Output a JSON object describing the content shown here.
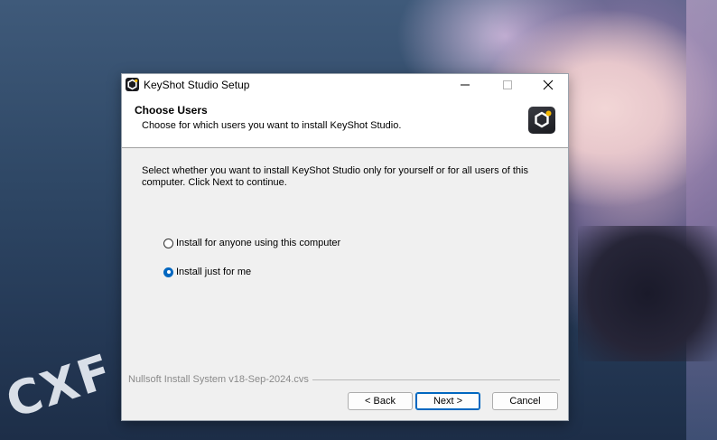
{
  "background": {
    "watermark_text": "CXF"
  },
  "window": {
    "title": "KeyShot Studio Setup",
    "controls": {
      "minimize_icon": "minimize-icon",
      "maximize_icon": "maximize-icon",
      "close_icon": "close-icon"
    }
  },
  "header": {
    "title": "Choose Users",
    "subtitle": "Choose for which users you want to install KeyShot Studio."
  },
  "body": {
    "description": "Select whether you want to install KeyShot Studio only for yourself or for all users of this computer. Click Next to continue.",
    "options": [
      {
        "label": "Install for anyone using this computer",
        "selected": false
      },
      {
        "label": "Install just for me",
        "selected": true
      }
    ]
  },
  "footer": {
    "branding": "Nullsoft Install System v18-Sep-2024.cvs",
    "back_label": "< Back",
    "next_label": "Next >",
    "cancel_label": "Cancel"
  },
  "colors": {
    "accent": "#0067c0",
    "window_bg": "#f0f0f0",
    "header_bg": "#ffffff"
  }
}
